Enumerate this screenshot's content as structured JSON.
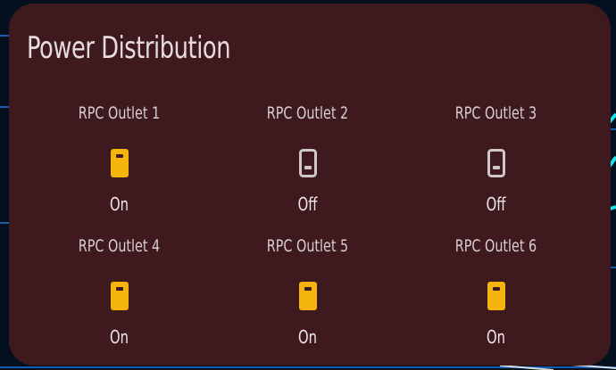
{
  "card": {
    "title": "Power Distribution"
  },
  "colors": {
    "on": "#f6b40e",
    "off": "#cfc8c8",
    "card_bg": "#3e1a1f"
  },
  "outlets": [
    {
      "name": "RPC Outlet 1",
      "state": "On",
      "icon": "power-socket-on-icon"
    },
    {
      "name": "RPC Outlet 2",
      "state": "Off",
      "icon": "power-socket-off-icon"
    },
    {
      "name": "RPC Outlet 3",
      "state": "Off",
      "icon": "power-socket-off-icon"
    },
    {
      "name": "RPC Outlet 4",
      "state": "On",
      "icon": "power-socket-on-icon"
    },
    {
      "name": "RPC Outlet 5",
      "state": "On",
      "icon": "power-socket-on-icon"
    },
    {
      "name": "RPC Outlet 6",
      "state": "On",
      "icon": "power-socket-on-icon"
    }
  ]
}
